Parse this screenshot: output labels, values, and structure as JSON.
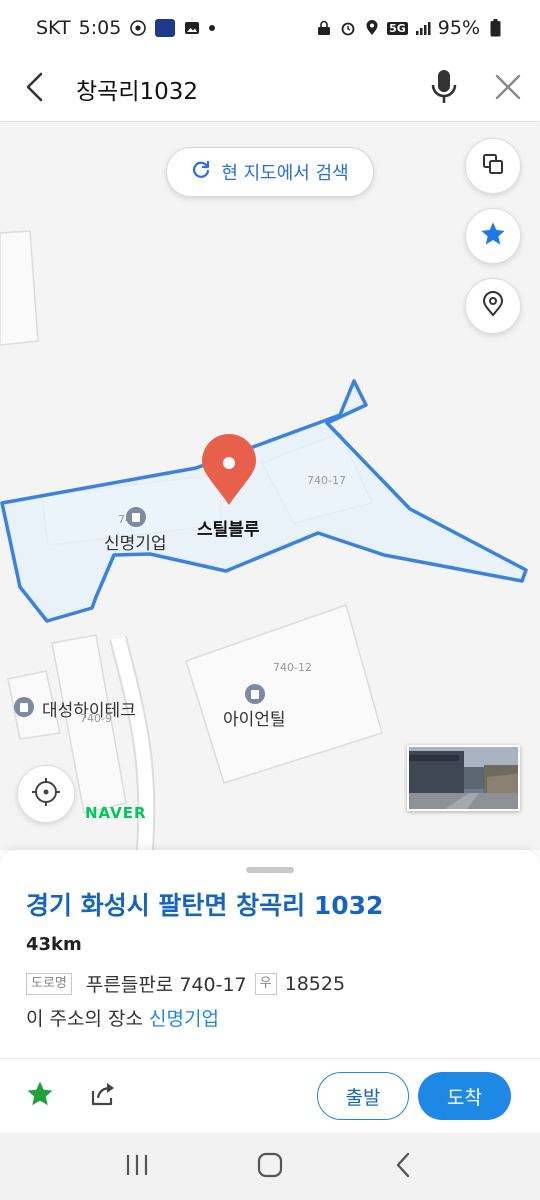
{
  "status_bar": {
    "carrier": "SKT",
    "time": "5:05",
    "network": "5G",
    "battery": "95%"
  },
  "search": {
    "query": "창곡리1032"
  },
  "map": {
    "search_here_label": "현 지도에서 검색",
    "labels": {
      "company_main": "신명기업",
      "pin_place": "스틸블루",
      "lot_top": "740-17",
      "lot_mid": "740-12",
      "lot_left": "740-9",
      "company_left": "대성하이테크",
      "company_right": "아이언틸",
      "lot_small": "740"
    },
    "brand": "NAVER",
    "pin_color": "#e8604c",
    "outline_color": "#3b82e0"
  },
  "sheet": {
    "address": "경기 화성시 팔탄면 창곡리 1032",
    "distance": "43km",
    "road_tag": "도로명",
    "road_address": "푸른들판로 740-17",
    "zip_tag": "우",
    "zip": "18525",
    "place_prefix": "이 주소의 장소",
    "place_name": "신명기업",
    "depart_label": "출발",
    "arrive_label": "도착",
    "accent_color": "#1e88e5"
  },
  "icons": {
    "back": "back-arrow-icon",
    "mic": "microphone-icon",
    "close": "close-icon",
    "layers": "layers-icon",
    "favorite": "star-icon",
    "location_pin": "location-pin-icon",
    "locate_me": "crosshair-icon",
    "share": "share-icon"
  }
}
